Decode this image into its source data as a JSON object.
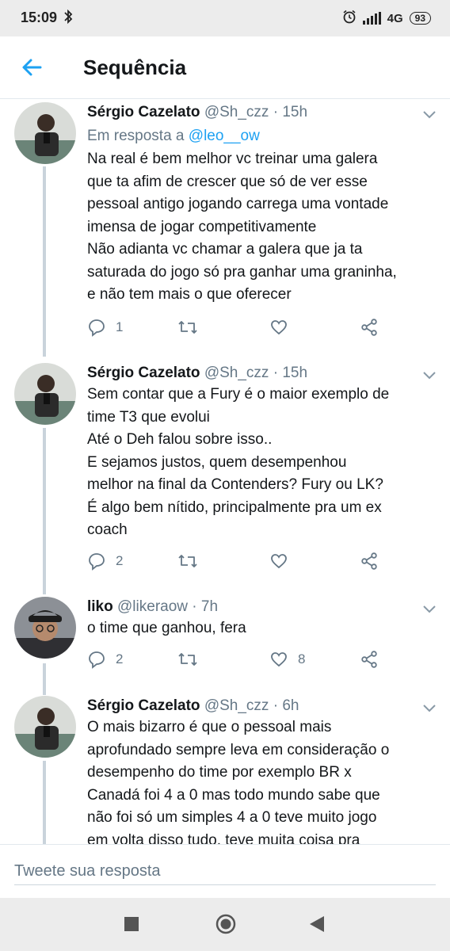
{
  "status_bar": {
    "time": "15:09",
    "network": "4G",
    "battery": "93",
    "icons": [
      "bluetooth-icon",
      "alarm-icon",
      "signal-icon",
      "battery-icon"
    ]
  },
  "header": {
    "title": "Sequência",
    "back_icon": "back-arrow-icon"
  },
  "colors": {
    "accent": "#1da1f2",
    "secondary_text": "#657786",
    "thread_line": "#c9d3db"
  },
  "tweets": [
    {
      "name": "Sérgio Cazelato",
      "handle": "@Sh_czz",
      "time": "· 15h",
      "reply_prefix": "Em resposta a",
      "reply_mention": "@leo__ow",
      "text": "Na real é bem melhor vc treinar uma galera\nque ta afim de crescer que só de ver esse\npessoal antigo jogando carrega uma vontade\nimensa de jogar competitivamente\nNão adianta vc chamar a galera que ja ta\nsaturada do jogo só pra ganhar uma graninha,\ne não tem mais o que oferecer",
      "reply_count": "1",
      "retweet_count": "",
      "like_count": ""
    },
    {
      "name": "Sérgio Cazelato",
      "handle": "@Sh_czz",
      "time": "· 15h",
      "text": "Sem contar que a Fury é o maior exemplo de\ntime T3 que evolui\nAté o Deh falou sobre isso..\nE sejamos justos, quem desempenhou\nmelhor na final da Contenders? Fury ou LK?\nÉ algo bem nítido, principalmente pra um ex\ncoach",
      "reply_count": "2",
      "retweet_count": "",
      "like_count": ""
    },
    {
      "name": "liko",
      "handle": "@likeraow",
      "time": "· 7h",
      "text": "o time que ganhou, fera",
      "reply_count": "2",
      "retweet_count": "",
      "like_count": "8"
    },
    {
      "name": "Sérgio Cazelato",
      "handle": "@Sh_czz",
      "time": "· 6h",
      "text": "O mais bizarro é que o pessoal mais\naprofundado sempre leva em consideração o\ndesempenho do time por exemplo BR x\nCanadá foi 4 a 0 mas todo mundo sabe que\nnão foi só um simples 4 a 0 teve muito jogo\nem volta disso tudo, teve muita coisa pra"
    }
  ],
  "compose": {
    "placeholder": "Tweete sua resposta"
  },
  "nav_bar": {
    "icons": [
      "recents-square-icon",
      "home-circle-icon",
      "back-triangle-icon"
    ]
  }
}
